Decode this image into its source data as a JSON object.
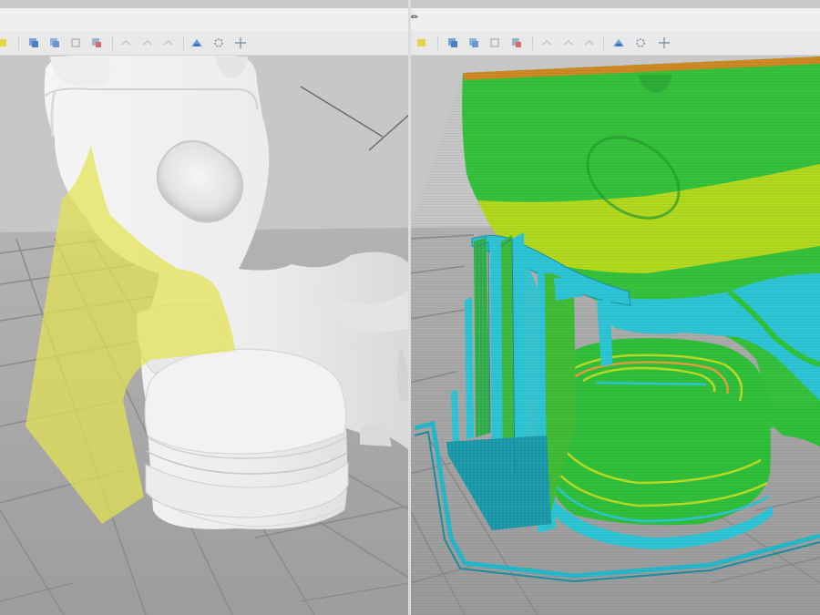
{
  "left_view": {
    "toolbar_icons": [
      "add-object-icon",
      "arrange-icon",
      "copy-icon",
      "delete-icon",
      "undo-icon",
      "redo-icon",
      "search-icon",
      "layers-icon",
      "settings-icon",
      "move-icon"
    ],
    "colors": {
      "background": "#c3c3c3",
      "bed_grid": "#8f8f8f",
      "model": "#f1f1f1",
      "support_highlight": "#e7e563"
    }
  },
  "right_view": {
    "toolbar_icons": [
      "add-object-icon",
      "arrange-icon",
      "copy-icon",
      "delete-icon",
      "undo-icon",
      "redo-icon",
      "search-icon",
      "layers-icon",
      "settings-icon",
      "move-icon"
    ],
    "colors": {
      "background": "#c3c3c3",
      "bed_grid": "#8f8f8f",
      "layer_green": "#35c93f",
      "layer_yellow": "#b7dd1e",
      "support_cyan": "#2ec6d6",
      "top_orange": "#cf8a24"
    }
  }
}
